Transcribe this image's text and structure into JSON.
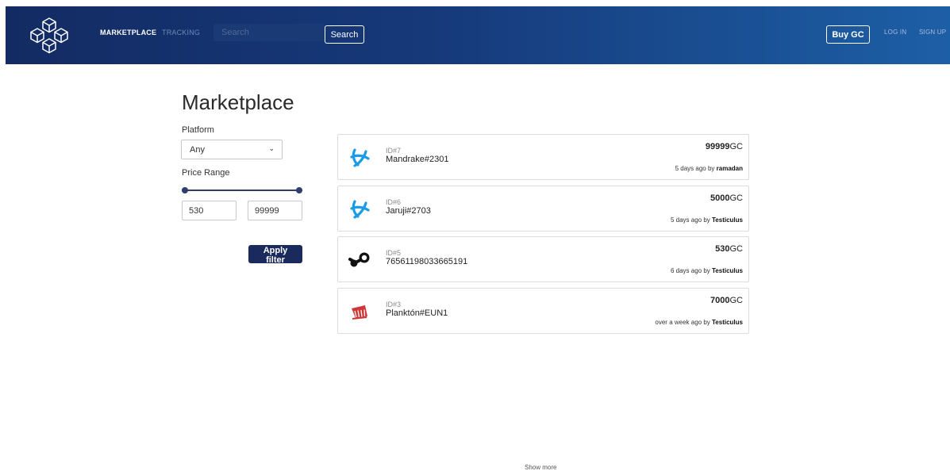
{
  "colors": {
    "navbar_start": "#132b63",
    "navbar_end": "#1d5fa6",
    "primary_button": "#1b2a5c",
    "battlenet_blue": "#1a9be8",
    "steam_black": "#111111",
    "riot_red": "#d13639"
  },
  "nav": {
    "logo_icon": "cubes-logo-icon",
    "links": {
      "marketplace": "MARKETPLACE",
      "tracking": "TRACKING"
    },
    "search": {
      "placeholder": "Search",
      "value": "",
      "button": "Search"
    },
    "buy_gc": "Buy GC",
    "login": "LOG IN",
    "signup": "SIGN UP"
  },
  "sidebar": {
    "title": "Marketplace",
    "platform_label": "Platform",
    "platform_selected": "Any",
    "price_label": "Price Range",
    "price_range": {
      "min": 530,
      "max": 99999,
      "slider_min_pct": 0,
      "slider_max_pct": 100
    },
    "price_min_value": "530",
    "price_max_value": "99999",
    "apply_button": "Apply filter"
  },
  "listings": [
    {
      "id_prefix": "ID",
      "id_hash": "#7",
      "name": "Mandrake#2301",
      "price": "99999",
      "currency": "GC",
      "time": "5 days ago by",
      "user": "ramadan",
      "icon": "battlenet-icon"
    },
    {
      "id_prefix": "ID",
      "id_hash": "#6",
      "name": "Jaruji#2703",
      "price": "5000",
      "currency": "GC",
      "time": "5 days ago by",
      "user": "Testiculus",
      "icon": "battlenet-icon"
    },
    {
      "id_prefix": "ID",
      "id_hash": "#5",
      "name": "76561198033665191",
      "price": "530",
      "currency": "GC",
      "time": "6 days ago by",
      "user": "Testiculus",
      "icon": "steam-icon"
    },
    {
      "id_prefix": "ID",
      "id_hash": "#3",
      "name": "Planktón#EUN1",
      "price": "7000",
      "currency": "GC",
      "time": "over a week ago by",
      "user": "Testiculus",
      "icon": "riot-games-icon"
    }
  ],
  "show_more": "Show more"
}
